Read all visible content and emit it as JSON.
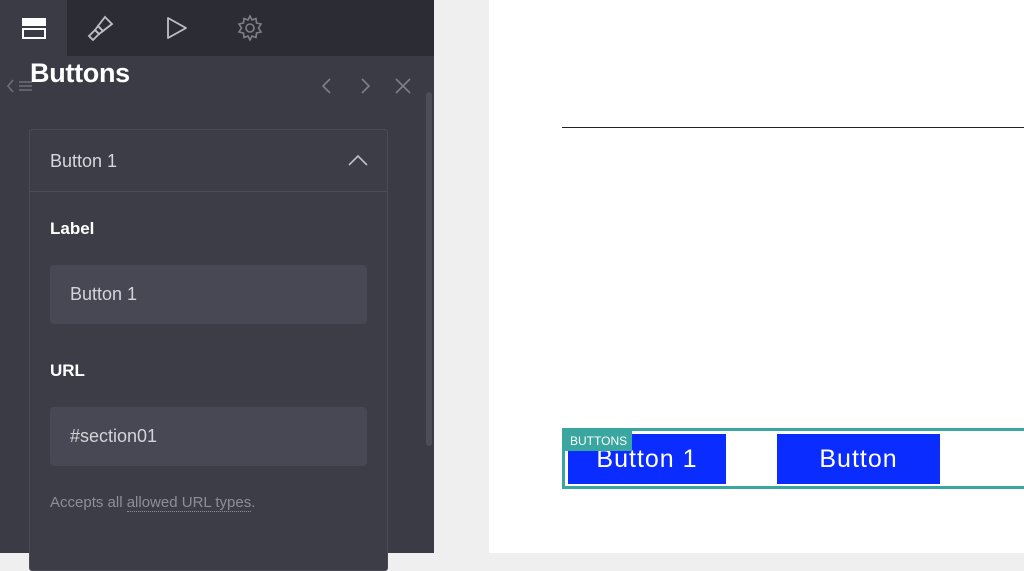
{
  "topbar": {
    "tabs": [
      {
        "icon": "layout-icon",
        "active": true
      },
      {
        "icon": "brush-icon",
        "active": false
      },
      {
        "icon": "play-icon",
        "active": false
      },
      {
        "icon": "gear-icon",
        "active": false
      }
    ]
  },
  "panel": {
    "title": "Buttons",
    "card": {
      "title": "Button 1",
      "label_field": {
        "label": "Label",
        "value": "Button 1"
      },
      "url_field": {
        "label": "URL",
        "value": "#section01"
      },
      "help_prefix": "Accepts all ",
      "help_link": "allowed URL types",
      "help_suffix": "."
    }
  },
  "canvas": {
    "block_tag": "BUTTONS",
    "buttons": [
      {
        "label": "Button 1"
      },
      {
        "label": "Button"
      }
    ]
  },
  "colors": {
    "sidebar_bg": "#3a3b45",
    "topbar_bg": "#2c2d34",
    "accent_teal": "#3aa6a0",
    "button_blue": "#0a2cff"
  }
}
